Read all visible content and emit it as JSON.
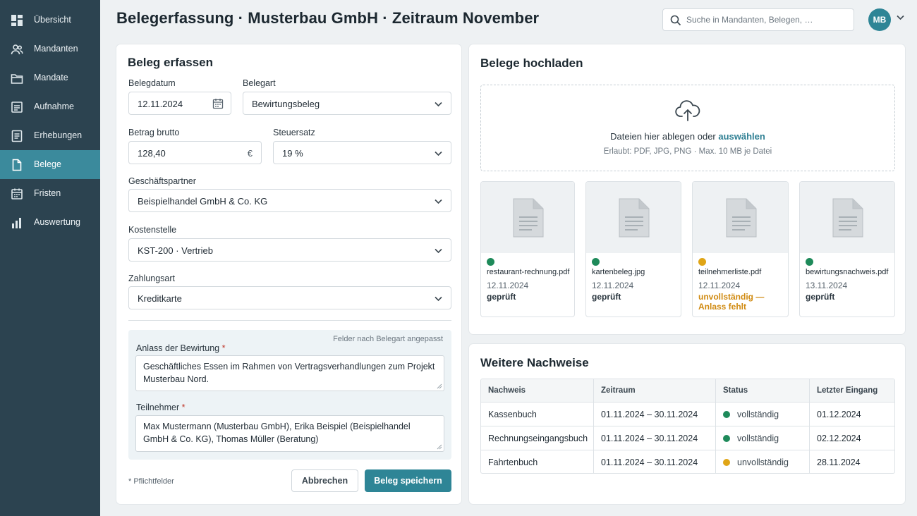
{
  "header": {
    "title": "Belegerfassung · Musterbau GmbH · Zeitraum November",
    "search_placeholder": "Suche in Mandanten, Belegen, …",
    "avatar_initials": "MB"
  },
  "sidebar": {
    "items": [
      {
        "label": "Übersicht",
        "icon": "dashboard-icon"
      },
      {
        "label": "Mandanten",
        "icon": "users-icon"
      },
      {
        "label": "Mandate",
        "icon": "folder-icon"
      },
      {
        "label": "Aufnahme",
        "icon": "clipboard-icon"
      },
      {
        "label": "Erhebungen",
        "icon": "list-icon"
      },
      {
        "label": "Belege",
        "icon": "document-icon",
        "active": true
      },
      {
        "label": "Fristen",
        "icon": "calendar-icon"
      },
      {
        "label": "Auswertung",
        "icon": "bar-chart-icon"
      }
    ]
  },
  "form": {
    "title": "Beleg erfassen",
    "belegdatum_label": "Belegdatum",
    "belegdatum_value": "12.11.2024",
    "belegart_label": "Belegart",
    "belegart_value": "Bewirtungsbeleg",
    "betrag_label": "Betrag brutto",
    "betrag_value": "128,40",
    "betrag_currency": "€",
    "steuersatz_label": "Steuersatz",
    "steuersatz_value": "19 %",
    "partner_label": "Geschäftspartner",
    "partner_value": "Beispielhandel GmbH & Co. KG",
    "kostenstelle_label": "Kostenstelle",
    "kostenstelle_value": "KST-200 · Vertrieb",
    "zahlungsart_label": "Zahlungsart",
    "zahlungsart_value": "Kreditkarte",
    "context_note": "Felder nach Belegart angepasst",
    "anlass_label": "Anlass der Bewirtung",
    "anlass_value": "Geschäftliches Essen im Rahmen von Vertragsverhandlungen zum Projekt Musterbau Nord.",
    "teilnehmer_label": "Teilnehmer",
    "teilnehmer_value": "Max Mustermann (Musterbau GmbH), Erika Beispiel (Beispielhandel GmbH & Co. KG), Thomas Müller (Beratung)",
    "required_marker": "*",
    "pflicht_note": "* Pflichtfelder",
    "cancel_label": "Abbrechen",
    "save_label": "Beleg speichern"
  },
  "upload": {
    "title": "Belege hochladen",
    "drop_text": "Dateien hier ablegen oder",
    "drop_link": "auswählen",
    "drop_hint": "Erlaubt: PDF, JPG, PNG · Max. 10 MB je Datei",
    "files": [
      {
        "name": "restaurant-rechnung.pdf",
        "date": "12.11.2024",
        "status": "geprüft",
        "state": "ok"
      },
      {
        "name": "kartenbeleg.jpg",
        "date": "12.11.2024",
        "status": "geprüft",
        "state": "ok"
      },
      {
        "name": "teilnehmerliste.pdf",
        "date": "12.11.2024",
        "status": "unvollständig — Anlass fehlt",
        "state": "warn"
      },
      {
        "name": "bewirtungsnachweis.pdf",
        "date": "13.11.2024",
        "status": "geprüft",
        "state": "ok"
      }
    ]
  },
  "nachweise": {
    "title": "Weitere Nachweise",
    "columns": [
      "Nachweis",
      "Zeitraum",
      "Status",
      "Letzter Eingang"
    ],
    "rows": [
      {
        "nachweis": "Kassenbuch",
        "zeitraum": "01.11.2024 – 30.11.2024",
        "status": "vollständig",
        "state": "ok",
        "eingang": "01.12.2024"
      },
      {
        "nachweis": "Rechnungseingangsbuch",
        "zeitraum": "01.11.2024 – 30.11.2024",
        "status": "vollständig",
        "state": "ok",
        "eingang": "02.12.2024"
      },
      {
        "nachweis": "Fahrtenbuch",
        "zeitraum": "01.11.2024 – 30.11.2024",
        "status": "unvollständig",
        "state": "warn",
        "eingang": "28.11.2024"
      }
    ]
  },
  "colors": {
    "sidebar_bg": "#2c4350",
    "accent": "#2e8596",
    "status_ok": "#1e8a5a",
    "status_warn": "#e0a516"
  }
}
